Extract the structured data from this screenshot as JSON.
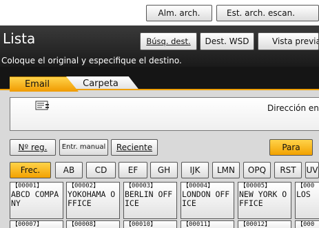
{
  "top_buttons": {
    "alm": "Alm. arch.",
    "est": "Est. arch. escan."
  },
  "header": {
    "title": "Lista",
    "subtitle": "Coloque el original y especifique el destino.",
    "busq_label": "Búsq. dest.",
    "wsd_label": "Dest. WSD",
    "vista_label": "Vista previa"
  },
  "tabs": {
    "email": "Email",
    "carpeta": "Carpeta"
  },
  "destination": {
    "placeholder_text": "Dirección en"
  },
  "controls": {
    "nreg": "Nº reg.",
    "entr": "Entr. manual",
    "reciente": "Reciente",
    "para": "Para"
  },
  "index_tabs": [
    "Frec.",
    "AB",
    "CD",
    "EF",
    "GH",
    "IJK",
    "LMN",
    "OPQ",
    "RST",
    "UV"
  ],
  "entries": [
    {
      "num": "【00001】",
      "name": "ABCD COMPANY"
    },
    {
      "num": "【00002】",
      "name": "YOKOHAMA OFFICE"
    },
    {
      "num": "【00003】",
      "name": "BERLIN OFFICE"
    },
    {
      "num": "【00004】",
      "name": "LONDON OFFICE"
    },
    {
      "num": "【00005】",
      "name": "NEW YORK OFFICE"
    },
    {
      "num": "【000",
      "name": "LOS"
    }
  ],
  "entries_row2": [
    "【00007】",
    "【00008】",
    "【00010】",
    "【00011】",
    "【00012】",
    "【000"
  ],
  "colors": {
    "accent": "#f2a100",
    "title_bg": "#1a1a1a",
    "panel_bg": "#d9d9d9"
  },
  "icons": {
    "destination": "envelope-list-icon"
  }
}
